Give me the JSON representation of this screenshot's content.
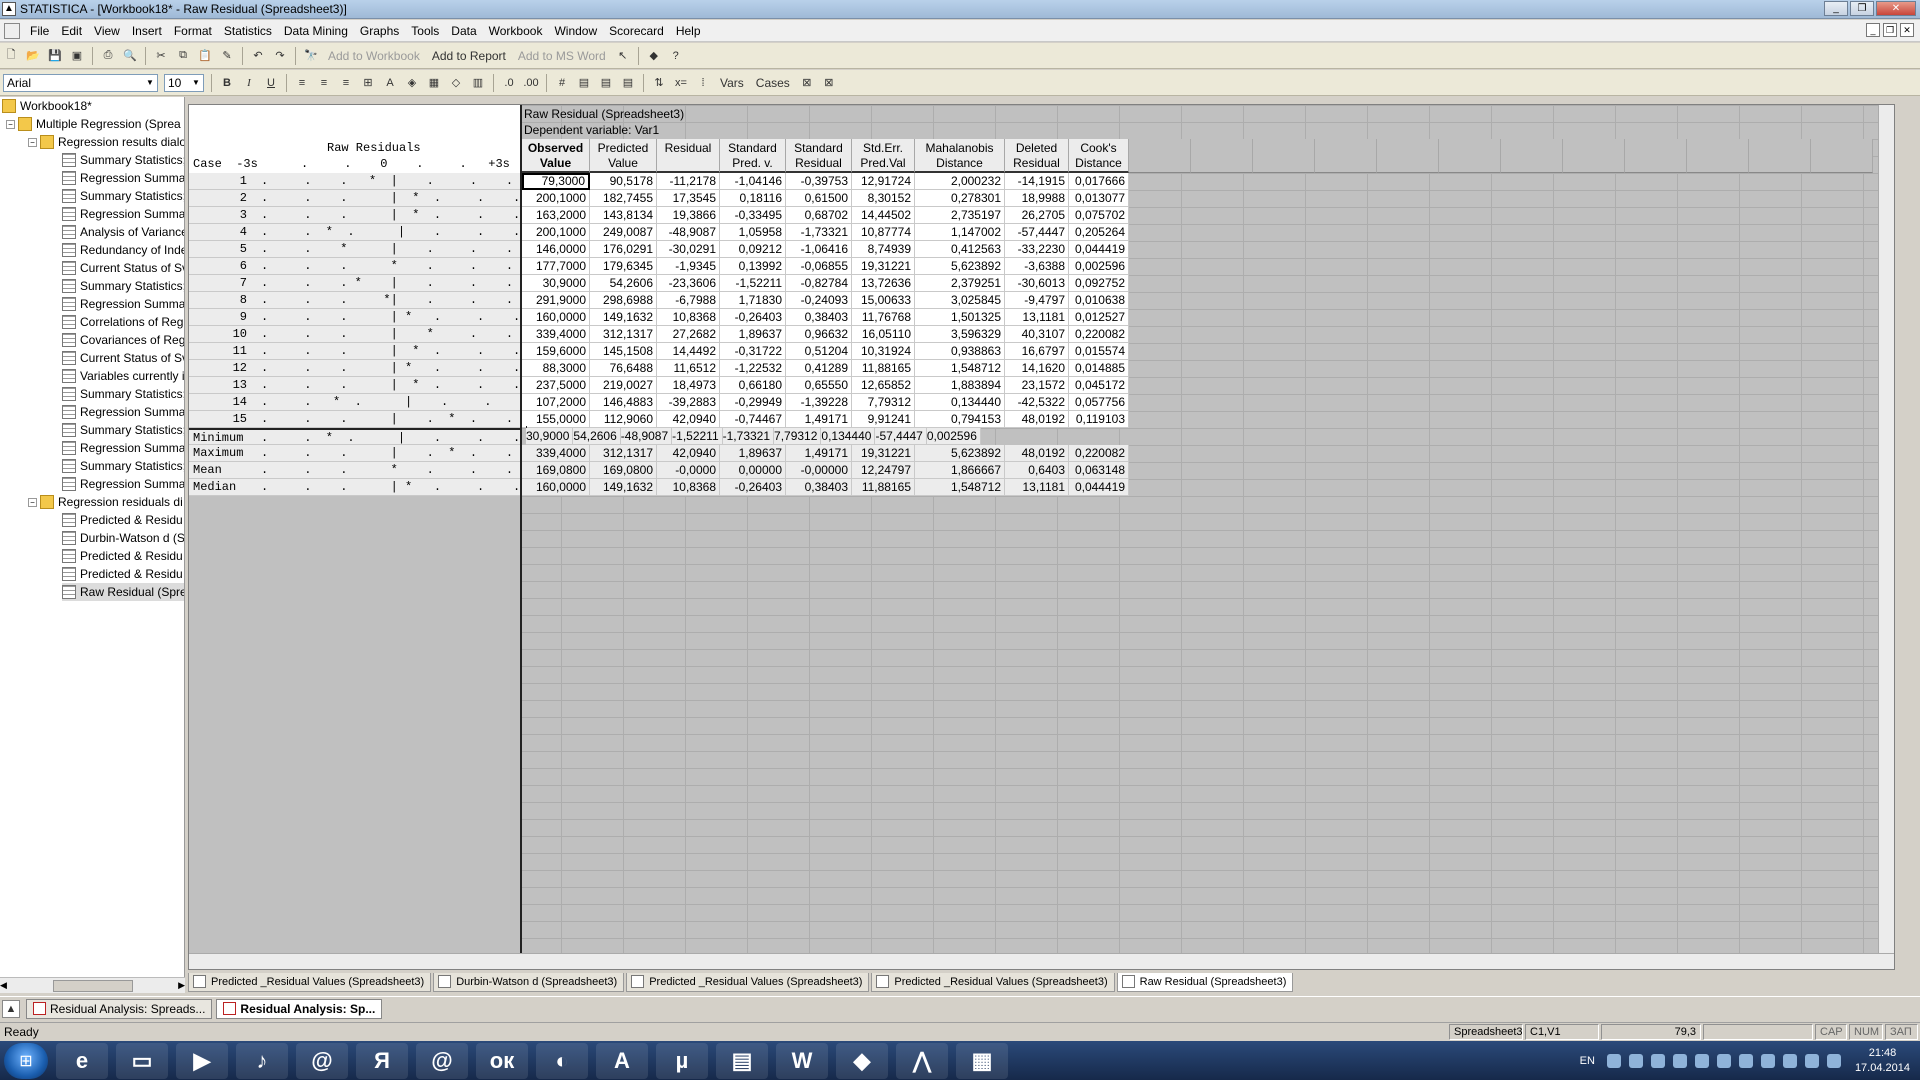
{
  "window": {
    "title": "STATISTICA - [Workbook18* - Raw Residual (Spreadsheet3)]"
  },
  "menu": [
    "File",
    "Edit",
    "View",
    "Insert",
    "Format",
    "Statistics",
    "Data Mining",
    "Graphs",
    "Tools",
    "Data",
    "Workbook",
    "Window",
    "Scorecard",
    "Help"
  ],
  "toolbar1": {
    "add_to_workbook": "Add to Workbook",
    "add_to_report": "Add to Report",
    "add_to_ms_word": "Add to MS Word"
  },
  "toolbar2": {
    "font": "Arial",
    "size": "10",
    "bold": "B",
    "italic": "I",
    "underline": "U",
    "vars": "Vars",
    "cases": "Cases"
  },
  "tree": {
    "root": "Workbook18*",
    "analysis": "Multiple Regression (Sprea",
    "group1": "Regression results dialo",
    "group1_items": [
      "Summary Statistics;",
      "Regression Summa",
      "Summary Statistics;",
      "Regression Summa",
      "Analysis of Variance",
      "Redundancy of Inde",
      "Current Status of Sv",
      "Summary Statistics;",
      "Regression Summa",
      "Correlations of Reg",
      "Covariances of Reg",
      "Current Status of Sv",
      "Variables currently i",
      "Summary Statistics;",
      "Regression Summa",
      "Summary Statistics;",
      "Regression Summa",
      "Summary Statistics;",
      "Regression Summa"
    ],
    "group2": "Regression residuals di",
    "group2_items": [
      "Predicted & Residu",
      "Durbin-Watson d (S",
      "Predicted & Residu",
      "Predicted & Residu",
      "Raw Residual (Sprea"
    ]
  },
  "sheet": {
    "title": "Raw Residual (Spreadsheet3)",
    "dependent": "Dependent variable: Var1",
    "raw_title": "Raw Residuals",
    "raw_axis": "Case  -3s      .     .    0    .     .   +3s",
    "columns": [
      {
        "l1": "Observed",
        "l2": "Value"
      },
      {
        "l1": "Predicted",
        "l2": "Value"
      },
      {
        "l1": "Residual",
        "l2": ""
      },
      {
        "l1": "Standard",
        "l2": "Pred. v."
      },
      {
        "l1": "Standard",
        "l2": "Residual"
      },
      {
        "l1": "Std.Err.",
        "l2": "Pred.Val"
      },
      {
        "l1": "Mahalanobis",
        "l2": "Distance"
      },
      {
        "l1": "Deleted",
        "l2": "Residual"
      },
      {
        "l1": "Cook's",
        "l2": "Distance"
      }
    ],
    "rows": [
      {
        "case": "1",
        "plot": ".     .    .   *  |    .     .    .",
        "v": [
          "79,3000",
          "90,5178",
          "-11,2178",
          "-1,04146",
          "-0,39753",
          "12,91724",
          "2,000232",
          "-14,1915",
          "0,017666"
        ]
      },
      {
        "case": "2",
        "plot": ".     .    .      |  *  .     .    .",
        "v": [
          "200,1000",
          "182,7455",
          "17,3545",
          "0,18116",
          "0,61500",
          "8,30152",
          "0,278301",
          "18,9988",
          "0,013077"
        ]
      },
      {
        "case": "3",
        "plot": ".     .    .      |  *  .     .    .",
        "v": [
          "163,2000",
          "143,8134",
          "19,3866",
          "-0,33495",
          "0,68702",
          "14,44502",
          "2,735197",
          "26,2705",
          "0,075702"
        ]
      },
      {
        "case": "4",
        "plot": ".     .  *  .      |    .     .    .",
        "v": [
          "200,1000",
          "249,0087",
          "-48,9087",
          "1,05958",
          "-1,73321",
          "10,87774",
          "1,147002",
          "-57,4447",
          "0,205264"
        ]
      },
      {
        "case": "5",
        "plot": ".     .    *      |    .     .    .",
        "v": [
          "146,0000",
          "176,0291",
          "-30,0291",
          "0,09212",
          "-1,06416",
          "8,74939",
          "0,412563",
          "-33,2230",
          "0,044419"
        ]
      },
      {
        "case": "6",
        "plot": ".     .    .      *    .     .    .",
        "v": [
          "177,7000",
          "179,6345",
          "-1,9345",
          "0,13992",
          "-0,06855",
          "19,31221",
          "5,623892",
          "-3,6388",
          "0,002596"
        ]
      },
      {
        "case": "7",
        "plot": ".     .    . *    |    .     .    .",
        "v": [
          "30,9000",
          "54,2606",
          "-23,3606",
          "-1,52211",
          "-0,82784",
          "13,72636",
          "2,379251",
          "-30,6013",
          "0,092752"
        ]
      },
      {
        "case": "8",
        "plot": ".     .    .     *|    .     .    .",
        "v": [
          "291,9000",
          "298,6988",
          "-6,7988",
          "1,71830",
          "-0,24093",
          "15,00633",
          "3,025845",
          "-9,4797",
          "0,010638"
        ]
      },
      {
        "case": "9",
        "plot": ".     .    .      | *   .     .    .",
        "v": [
          "160,0000",
          "149,1632",
          "10,8368",
          "-0,26403",
          "0,38403",
          "11,76768",
          "1,501325",
          "13,1181",
          "0,012527"
        ]
      },
      {
        "case": "10",
        "plot": ".     .    .      |    *     .    .",
        "v": [
          "339,4000",
          "312,1317",
          "27,2682",
          "1,89637",
          "0,96632",
          "16,05110",
          "3,596329",
          "40,3107",
          "0,220082"
        ]
      },
      {
        "case": "11",
        "plot": ".     .    .      |  *  .     .    .",
        "v": [
          "159,6000",
          "145,1508",
          "14,4492",
          "-0,31722",
          "0,51204",
          "10,31924",
          "0,938863",
          "16,6797",
          "0,015574"
        ]
      },
      {
        "case": "12",
        "plot": ".     .    .      | *   .     .    .",
        "v": [
          "88,3000",
          "76,6488",
          "11,6512",
          "-1,22532",
          "0,41289",
          "11,88165",
          "1,548712",
          "14,1620",
          "0,014885"
        ]
      },
      {
        "case": "13",
        "plot": ".     .    .      |  *  .     .    .",
        "v": [
          "237,5000",
          "219,0027",
          "18,4973",
          "0,66180",
          "0,65550",
          "12,65852",
          "1,883894",
          "23,1572",
          "0,045172"
        ]
      },
      {
        "case": "14",
        "plot": ".     .   *  .      |    .     .    .",
        "v": [
          "107,2000",
          "146,4883",
          "-39,2883",
          "-0,29949",
          "-1,39228",
          "7,79312",
          "0,134440",
          "-42,5322",
          "0,057756"
        ]
      },
      {
        "case": "15",
        "plot": ".     .    .      |    .  *  .    .",
        "v": [
          "155,0000",
          "112,9060",
          "42,0940",
          "-0,74467",
          "1,49171",
          "9,91241",
          "0,794153",
          "48,0192",
          "0,119103"
        ]
      }
    ],
    "stats": [
      {
        "case": "Minimum",
        "plot": ".     .  *  .      |    .     .    .",
        "v": [
          "30,9000",
          "54,2606",
          "-48,9087",
          "-1,52211",
          "-1,73321",
          "7,79312",
          "0,134440",
          "-57,4447",
          "0,002596"
        ]
      },
      {
        "case": "Maximum",
        "plot": ".     .    .      |    .  *  .    .",
        "v": [
          "339,4000",
          "312,1317",
          "42,0940",
          "1,89637",
          "1,49171",
          "19,31221",
          "5,623892",
          "48,0192",
          "0,220082"
        ]
      },
      {
        "case": "Mean",
        "plot": ".     .    .      *    .     .    .",
        "v": [
          "169,0800",
          "169,0800",
          "-0,0000",
          "0,00000",
          "-0,00000",
          "12,24797",
          "1,866667",
          "0,6403",
          "0,063148"
        ]
      },
      {
        "case": "Median",
        "plot": ".     .    .      | *   .     .    .",
        "v": [
          "160,0000",
          "149,1632",
          "10,8368",
          "-0,26403",
          "0,38403",
          "11,88165",
          "1,548712",
          "13,1181",
          "0,044419"
        ]
      }
    ]
  },
  "workbook_tabs": [
    "Predicted _Residual Values (Spreadsheet3)",
    "Durbin-Watson d (Spreadsheet3)",
    "Predicted _Residual Values (Spreadsheet3)",
    "Predicted _Residual Values (Spreadsheet3)",
    "Raw Residual (Spreadsheet3)"
  ],
  "doc_tabs": [
    "Residual Analysis: Spreads...",
    "Residual Analysis: Sp..."
  ],
  "status": {
    "ready": "Ready",
    "sheet": "Spreadsheet3",
    "cell": "C1,V1",
    "value": "79,3",
    "cap": "CAP",
    "num": "NUM",
    "zap": "ЗАП"
  },
  "taskbar": {
    "lang": "EN",
    "time": "21:48",
    "date": "17.04.2014"
  }
}
